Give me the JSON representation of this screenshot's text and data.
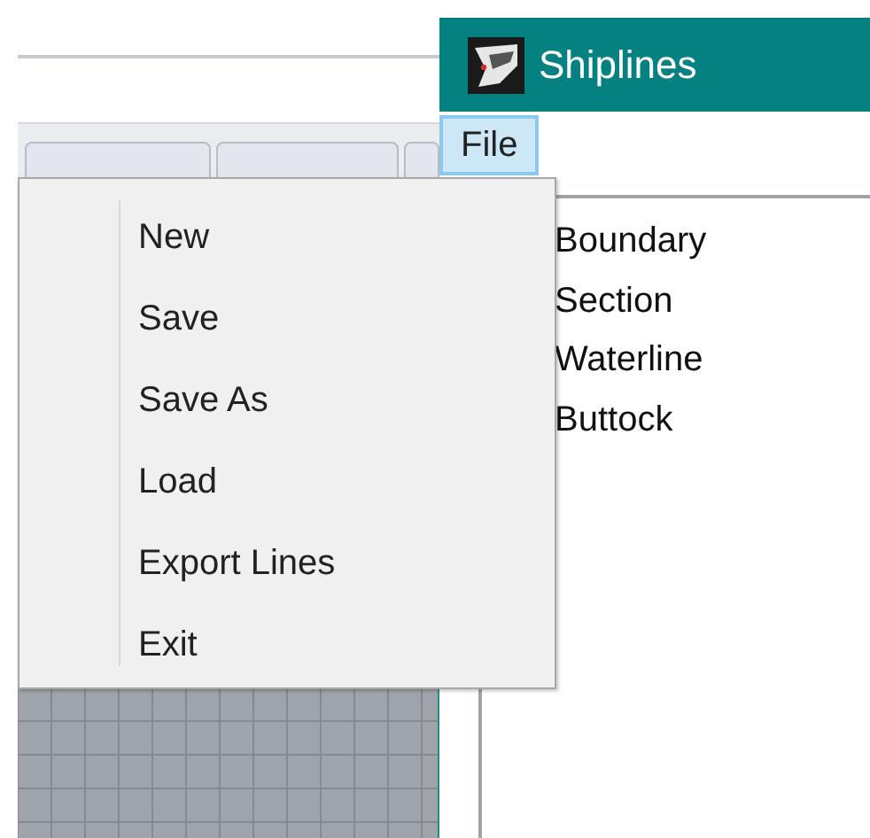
{
  "window": {
    "title": "Shiplines"
  },
  "menu_bar": [
    {
      "label": "File",
      "selected": true
    }
  ],
  "file_menu": [
    {
      "label": "New"
    },
    {
      "label": "Save"
    },
    {
      "label": "Save As"
    },
    {
      "label": "Load"
    },
    {
      "label": "Export Lines"
    },
    {
      "label": "Exit"
    }
  ],
  "list": [
    "Boundary",
    "Section",
    "Waterline",
    "Buttock"
  ]
}
